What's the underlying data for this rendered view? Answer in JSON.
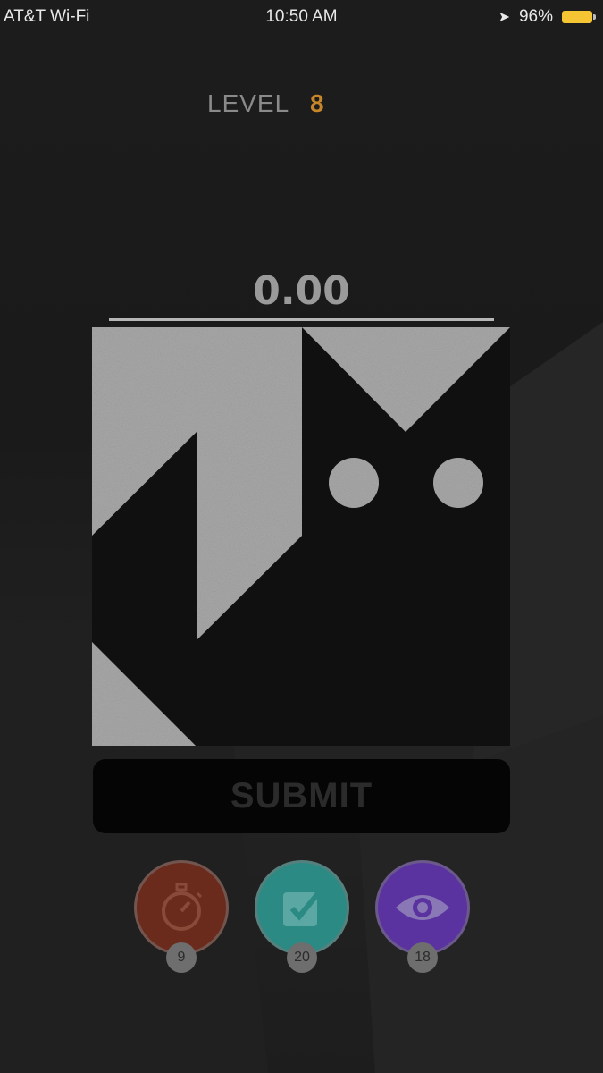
{
  "status_bar": {
    "carrier": "AT&T Wi-Fi",
    "time": "10:50 AM",
    "battery": "96%"
  },
  "level": {
    "label": "LEVEL",
    "number": "8"
  },
  "score": "0.00",
  "submit_label": "SUBMIT",
  "powerups": [
    {
      "name": "timer",
      "icon": "stopwatch-icon",
      "count": "9",
      "color": "#6a2a1c"
    },
    {
      "name": "check",
      "icon": "checkbox-icon",
      "count": "20",
      "color": "#2b8a84"
    },
    {
      "name": "reveal",
      "icon": "eye-icon",
      "count": "18",
      "color": "#5a33a0"
    }
  ]
}
